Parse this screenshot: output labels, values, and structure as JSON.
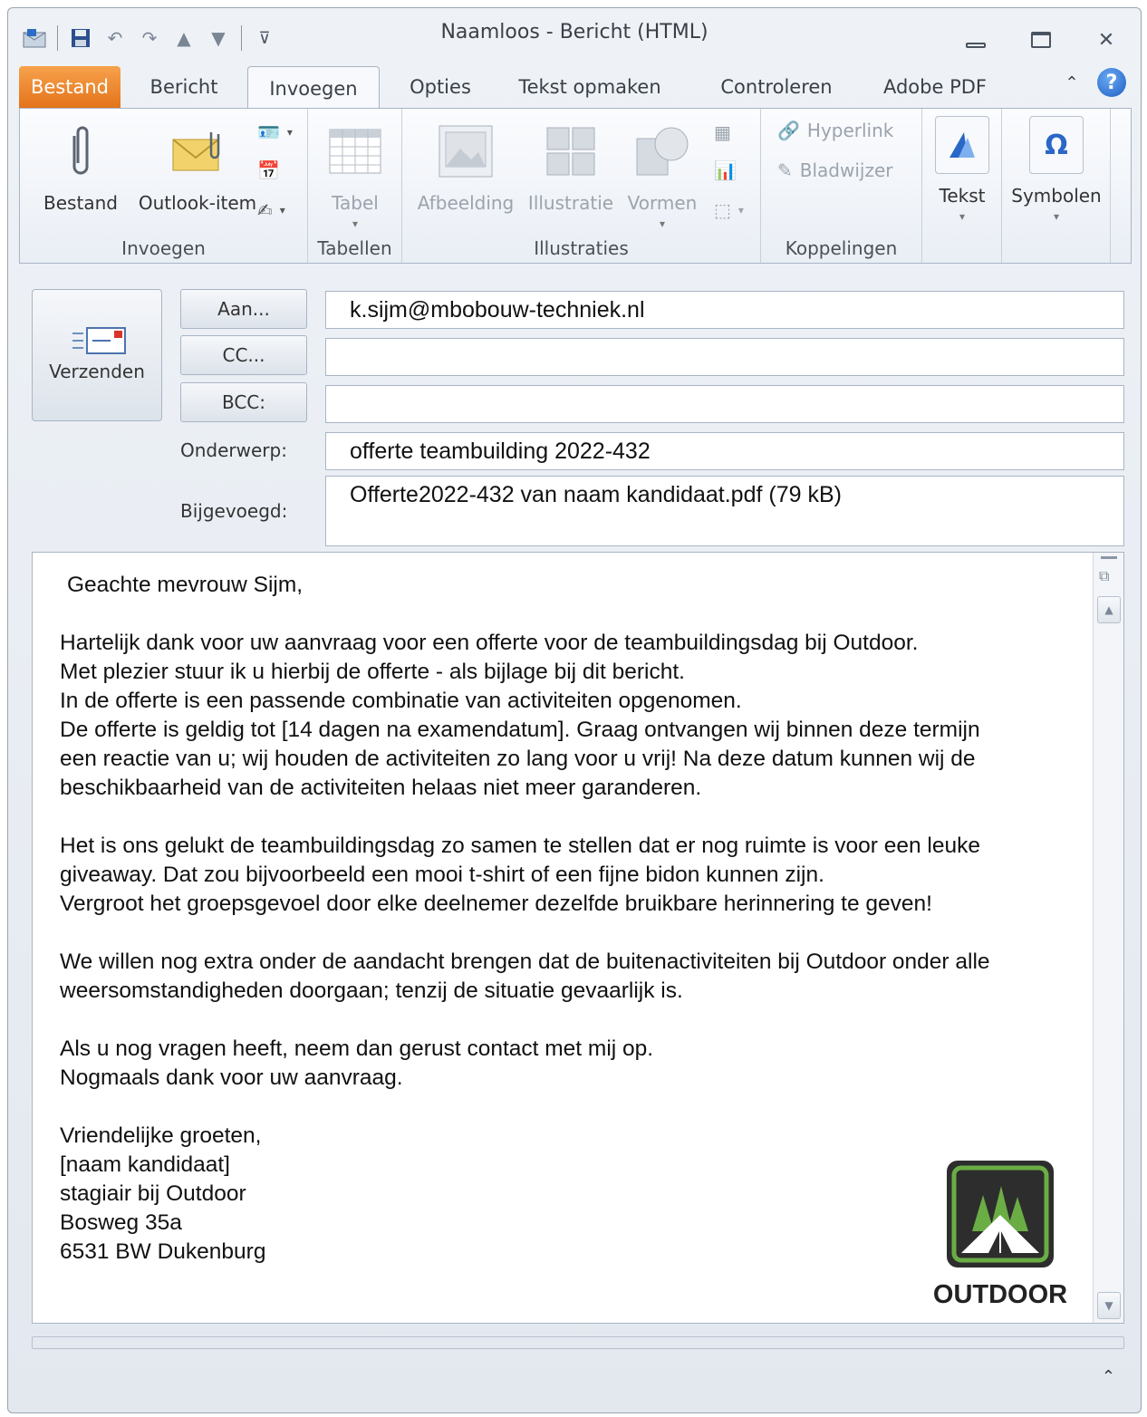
{
  "window": {
    "title": "Naamloos  -  Bericht (HTML)"
  },
  "tabs": [
    {
      "label": "Bestand"
    },
    {
      "label": "Bericht"
    },
    {
      "label": "Invoegen",
      "active": true
    },
    {
      "label": "Opties"
    },
    {
      "label": "Tekst opmaken"
    },
    {
      "label": "Controleren"
    },
    {
      "label": "Adobe PDF"
    }
  ],
  "ribbon": {
    "invoegen": {
      "label": "Invoegen",
      "bestand": "Bestand",
      "outlook_item": "Outlook-item"
    },
    "tabellen": {
      "label": "Tabellen",
      "tabel": "Tabel"
    },
    "illustraties": {
      "label": "Illustraties",
      "afbeelding": "Afbeelding",
      "illustratie": "Illustratie",
      "vormen": "Vormen"
    },
    "koppelingen": {
      "label": "Koppelingen",
      "hyperlink": "Hyperlink",
      "bladwijzer": "Bladwijzer"
    },
    "tekst": "Tekst",
    "symbolen": "Symbolen"
  },
  "compose": {
    "send_label": "Verzenden",
    "to_button": "Aan...",
    "cc_button": "CC...",
    "bcc_button": "BCC:",
    "subject_label": "Onderwerp:",
    "attached_label": "Bijgevoegd:",
    "to_value": "k.sijm@mbobouw-techniek.nl",
    "cc_value": "",
    "bcc_value": "",
    "subject_value": "offerte teambuilding 2022-432",
    "attachment": "Offerte2022-432 van naam kandidaat.pdf (79 kB)"
  },
  "body": {
    "greeting": "Geachte mevrouw Sijm,",
    "p1": [
      "Hartelijk dank voor uw aanvraag voor een offerte voor de teambuildingsdag bij Outdoor.",
      "Met plezier stuur ik u hierbij de offerte - als bijlage bij dit bericht.",
      "In de offerte is een passende combinatie van activiteiten opgenomen.",
      "De offerte is geldig tot [14 dagen na examendatum]. Graag ontvangen wij binnen deze termijn",
      "een reactie van u; wij houden de activiteiten zo lang voor u vrij! Na deze datum kunnen wij de",
      "beschikbaarheid van de activiteiten helaas niet meer garanderen."
    ],
    "p2": [
      "Het is ons gelukt de teambuildingsdag zo samen te stellen dat er nog ruimte is voor een leuke",
      "giveaway. Dat zou bijvoorbeeld een mooi t-shirt of een fijne bidon kunnen zijn.",
      "Vergroot het groepsgevoel door elke deelnemer dezelfde bruikbare herinnering te geven!"
    ],
    "p3": [
      "We willen nog extra onder de aandacht brengen dat de buitenactiviteiten bij Outdoor onder alle",
      "weersomstandigheden doorgaan; tenzij de situatie gevaarlijk is."
    ],
    "p4": [
      "Als u nog vragen heeft, neem dan gerust contact met mij op.",
      "Nogmaals dank voor uw aanvraag."
    ],
    "signature": [
      "Vriendelijke groeten,",
      "[naam kandidaat]",
      "stagiair bij Outdoor",
      "Bosweg 35a",
      "6531 BW Dukenburg"
    ],
    "logo_text": "OUTDOOR"
  },
  "colors": {
    "file_tab": "#e3731b",
    "accent_blue": "#1f5fc4",
    "logo_green": "#5a9e3c"
  }
}
